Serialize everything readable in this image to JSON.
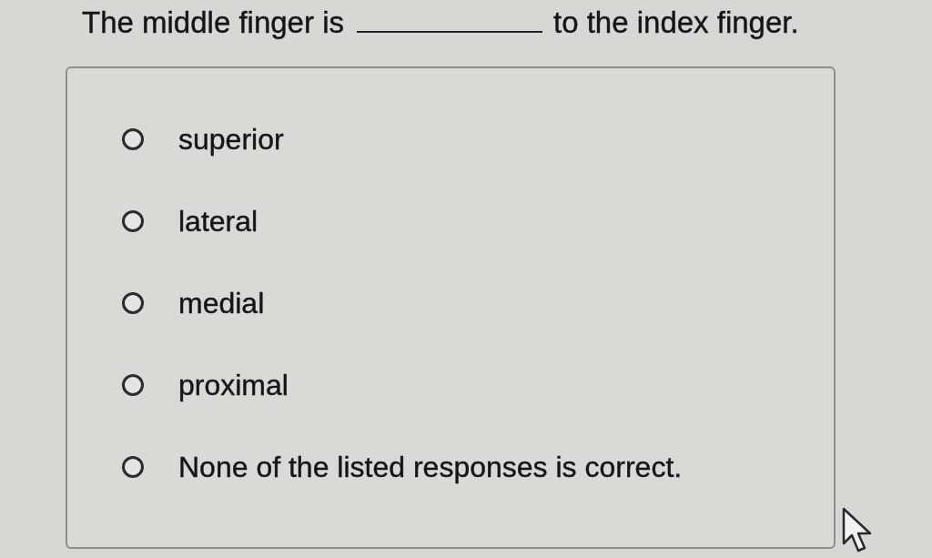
{
  "question": {
    "before_blank": "The middle finger is",
    "after_blank": "to the index finger."
  },
  "options": [
    {
      "label": "superior",
      "selected": false
    },
    {
      "label": "lateral",
      "selected": false
    },
    {
      "label": "medial",
      "selected": false
    },
    {
      "label": "proximal",
      "selected": false
    },
    {
      "label": "None of the listed responses is correct.",
      "selected": false
    }
  ]
}
